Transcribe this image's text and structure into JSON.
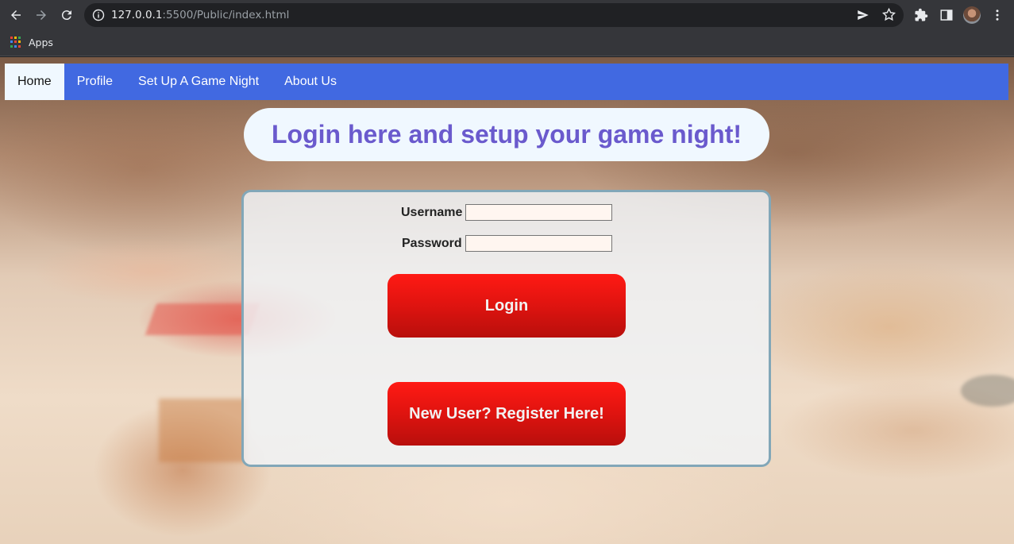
{
  "browser": {
    "url_host": "127.0.0.1",
    "url_rest": ":5500/Public/index.html",
    "bookmark_apps_label": "Apps"
  },
  "nav": {
    "items": [
      {
        "label": "Home",
        "active": true
      },
      {
        "label": "Profile",
        "active": false
      },
      {
        "label": "Set Up A Game Night",
        "active": false
      },
      {
        "label": "About Us",
        "active": false
      }
    ]
  },
  "banner": {
    "title": "Login here and setup your game night!"
  },
  "login": {
    "username_label": "Username",
    "username_value": "",
    "password_label": "Password",
    "password_value": "",
    "login_button": "Login",
    "register_button": "New User? Register Here!"
  },
  "colors": {
    "nav_bg": "#4169e1",
    "nav_active_bg": "#f0f8ff",
    "title_text": "#6a5acd",
    "button_red": "#e21410",
    "card_border": "#82a7b8"
  }
}
